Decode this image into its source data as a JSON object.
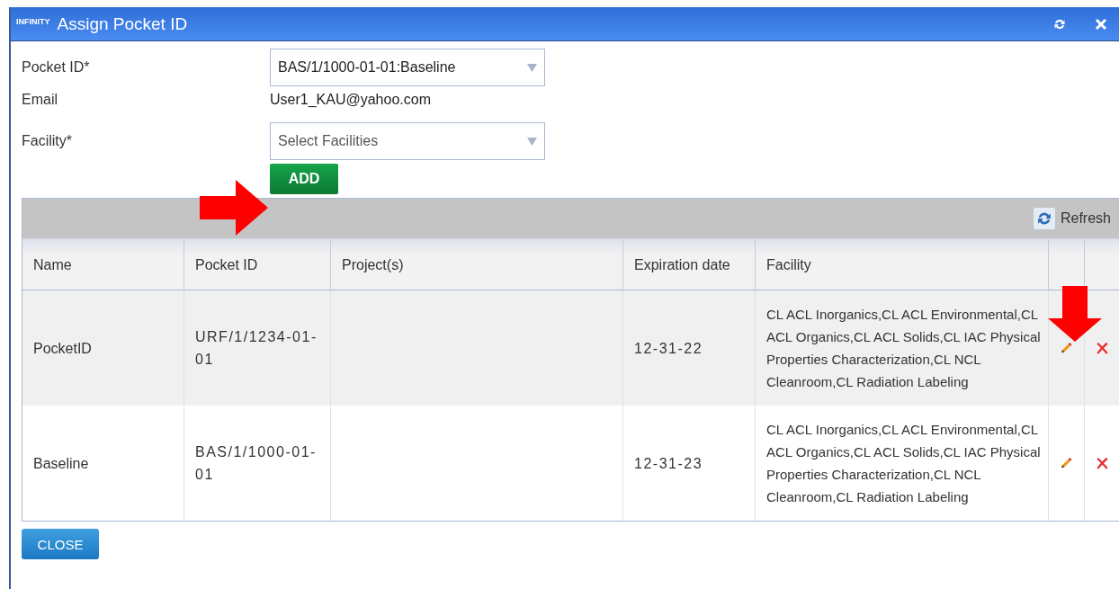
{
  "window": {
    "brand": "INFINITY",
    "title": "Assign Pocket ID"
  },
  "form": [
    {
      "label": "Pocket ID*",
      "kind": "select",
      "value": "BAS/1/1000-01-01:Baseline"
    },
    {
      "label": "Email",
      "kind": "text",
      "value": "User1_KAU@yahoo.com"
    },
    {
      "label": "Facility*",
      "kind": "select",
      "placeholder": "Select Facilities"
    }
  ],
  "add_button": "ADD",
  "toolbar": {
    "refresh": "Refresh"
  },
  "table": {
    "columns": [
      "Name",
      "Pocket ID",
      "Project(s)",
      "Expiration date",
      "Facility"
    ],
    "rows": [
      {
        "name": "PocketID",
        "pocket_id": "URF/1/1234-01-01",
        "expiration": "12-31-22",
        "facility": "CL ACL Inorganics,CL ACL Environmental,CL ACL Organics,CL ACL Solids,CL IAC Physical Properties Characterization,CL NCL Cleanroom,CL Radiation Labeling",
        "selected": true
      },
      {
        "name": "Baseline",
        "pocket_id": "BAS/1/1000-01-01",
        "expiration": "12-31-23",
        "facility": "CL ACL Inorganics,CL ACL Environmental,CL ACL Organics,CL ACL Solids,CL IAC Physical Properties Characterization,CL NCL Cleanroom,CL Radiation Labeling",
        "selected": false
      }
    ]
  },
  "close_button": "CLOSE"
}
